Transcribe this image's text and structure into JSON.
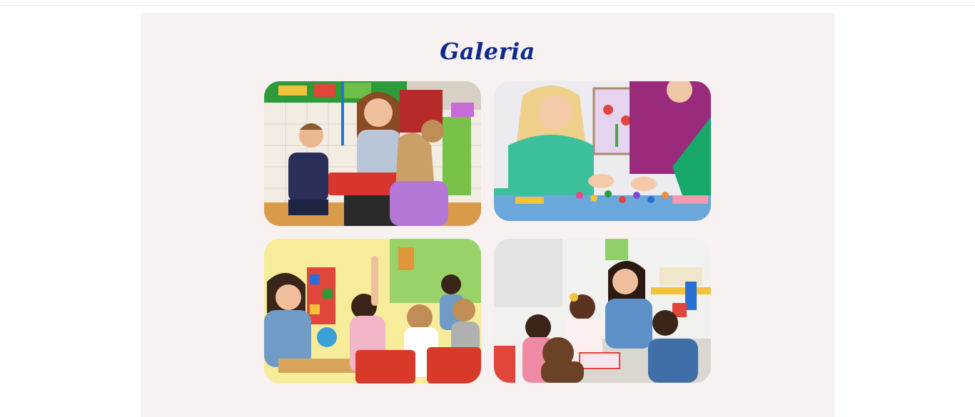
{
  "gallery": {
    "title": "Galeria",
    "photos": [
      {
        "name": "teacher-reading-to-children"
      },
      {
        "name": "children-crafting"
      },
      {
        "name": "classroom-raised-hands"
      },
      {
        "name": "teacher-writing-with-children"
      }
    ]
  },
  "colors": {
    "title": "#0e2a8c",
    "section_bg": "#f8f1f1",
    "page_bg": "#ffffff"
  }
}
